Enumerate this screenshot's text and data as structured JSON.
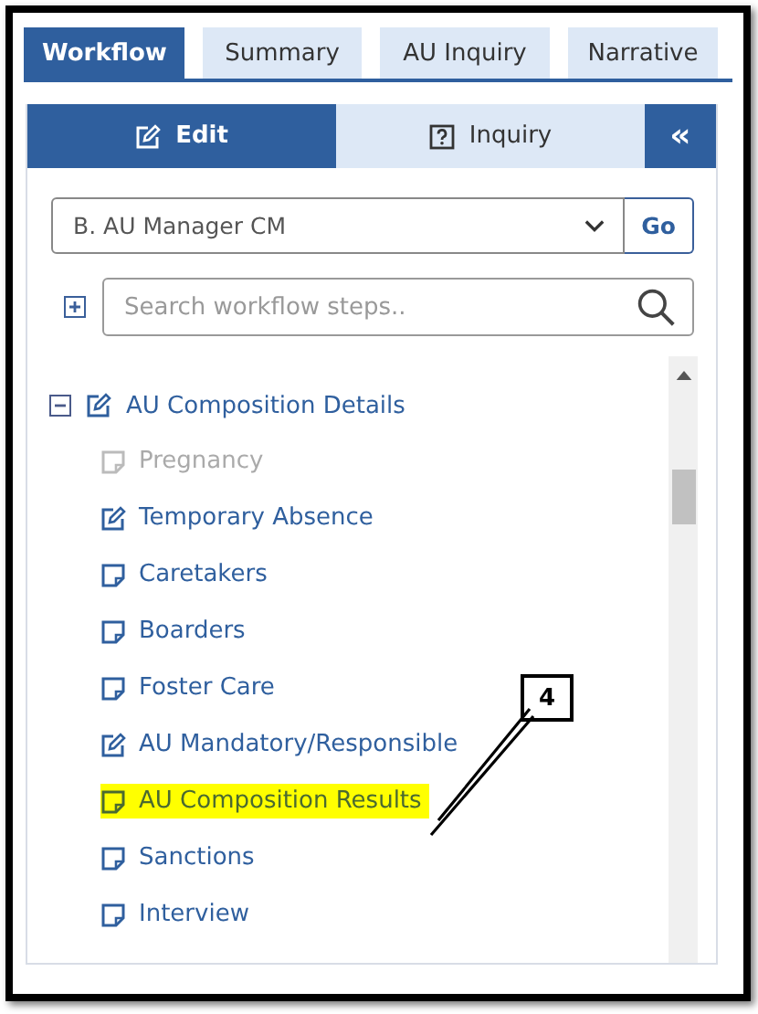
{
  "tabs": [
    {
      "label": "Workflow",
      "selected": true
    },
    {
      "label": "Summary",
      "selected": false
    },
    {
      "label": "AU Inquiry",
      "selected": false
    },
    {
      "label": "Narrative",
      "selected": false
    }
  ],
  "mode_tabs": [
    {
      "label": "Edit",
      "kind": "edit",
      "selected": true
    },
    {
      "label": "Inquiry",
      "kind": "inquiry",
      "selected": false
    }
  ],
  "collapse_button": {
    "label": "«"
  },
  "step_select": {
    "value": "B. AU Manager CM"
  },
  "go_button": {
    "label": "Go"
  },
  "search": {
    "placeholder": "Search workflow steps.."
  },
  "tree": [
    {
      "label": "AU Composition Details",
      "kind": "edit",
      "expanded": true,
      "children": [
        {
          "label": "Pregnancy",
          "kind": "note",
          "disabled": true,
          "highlighted": false
        },
        {
          "label": "Temporary Absence",
          "kind": "edit",
          "disabled": false,
          "highlighted": false
        },
        {
          "label": "Caretakers",
          "kind": "note",
          "disabled": false,
          "highlighted": false
        },
        {
          "label": "Boarders",
          "kind": "note",
          "disabled": false,
          "highlighted": false
        },
        {
          "label": "Foster Care",
          "kind": "note",
          "disabled": false,
          "highlighted": false
        },
        {
          "label": "AU Mandatory/Responsible",
          "kind": "edit",
          "disabled": false,
          "highlighted": false
        },
        {
          "label": "AU Composition Results",
          "kind": "note",
          "disabled": false,
          "highlighted": true
        },
        {
          "label": "Sanctions",
          "kind": "note",
          "disabled": false,
          "highlighted": false
        },
        {
          "label": "Interview",
          "kind": "note",
          "disabled": false,
          "highlighted": false
        }
      ]
    }
  ],
  "callout": {
    "label": "4"
  }
}
